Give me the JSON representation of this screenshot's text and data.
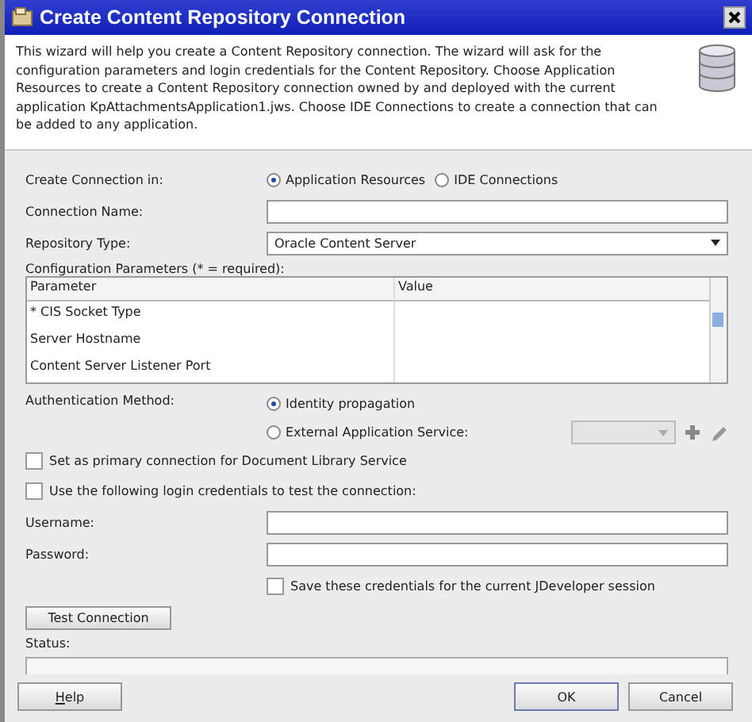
{
  "window": {
    "title": "Create Content Repository Connection"
  },
  "intro": "This wizard will help you create a Content Repository connection. The wizard will ask for the configuration parameters and login credentials for the Content Repository. Choose Application Resources to create a Content Repository connection owned by and deployed with the current application KpAttachmentsApplication1.jws. Choose IDE Connections to create a connection that can be added to any application.",
  "create_in": {
    "label": "Create Connection in:",
    "options": [
      {
        "label": "Application Resources",
        "selected": true
      },
      {
        "label": "IDE Connections",
        "selected": false
      }
    ]
  },
  "connection_name": {
    "label": "Connection Name:"
  },
  "repository_type": {
    "label": "Repository Type:",
    "value": "Oracle Content Server"
  },
  "config": {
    "label": "Configuration Parameters (* = required):",
    "columns": [
      "Parameter",
      "Value"
    ],
    "rows": [
      {
        "parameter": "* CIS Socket Type"
      },
      {
        "parameter": "Server Hostname"
      },
      {
        "parameter": "Content Server Listener Port"
      }
    ]
  },
  "auth": {
    "label": "Authentication Method:",
    "options": [
      {
        "label": "Identity propagation",
        "selected": true
      },
      {
        "label": "External Application Service:",
        "selected": false
      }
    ],
    "service_select": {
      "disabled": true
    }
  },
  "checkboxes": [
    {
      "label": "Set as primary connection for Document Library Service",
      "checked": false
    },
    {
      "label": "Use the following login credentials to test the connection:",
      "checked": false
    }
  ],
  "username": {
    "label": "Username:"
  },
  "password": {
    "label": "Password:"
  },
  "save_credentials": {
    "label": "Save these credentials for the current JDeveloper session",
    "checked": false
  },
  "test_button": "Test Connection",
  "status": {
    "label": "Status:"
  },
  "buttons": {
    "help": "Help",
    "ok": "OK",
    "cancel": "Cancel"
  }
}
